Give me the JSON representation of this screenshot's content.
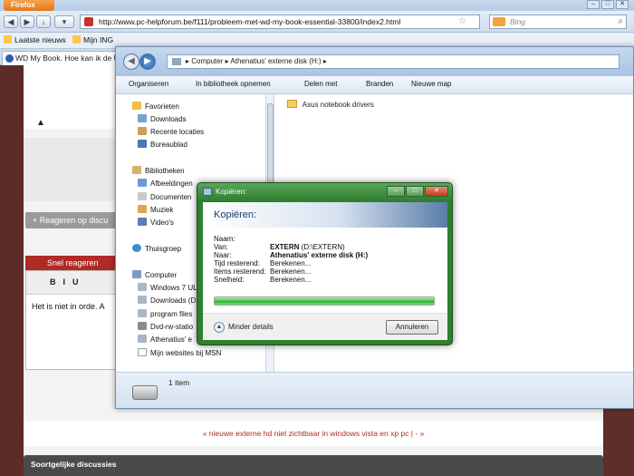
{
  "browser": {
    "menu_label": "Firefox",
    "url": "http://www.pc-helpforum.be/f111/probleem-met-wd-my-book-essential-33800/index2.html",
    "search_placeholder": "Bing",
    "bookmarks": [
      "Laatste nieuws",
      "Mijn ING"
    ],
    "tab_title": "WD My Book. Hoe kan ik de UI"
  },
  "forum": {
    "reply_button": "+ Reageren op discu",
    "quick_reply_title": "Snel reageren",
    "editor_text": "Het is niet in orde. A",
    "thread_nav": "« nieuwe externe hd niet zichtbaar in windows vista en xp pc | - »",
    "similar_title": "Soortgelijke discussies"
  },
  "explorer": {
    "path": [
      "Computer",
      "Athenatius' externe disk (H:)"
    ],
    "toolbar": [
      "Organiseren",
      "In bibliotheek opnemen",
      "Delen met",
      "Branden",
      "Nieuwe map"
    ],
    "nav": {
      "favorites_header": "Favorieten",
      "favorites": [
        "Downloads",
        "Recente locaties",
        "Bureaublad"
      ],
      "libraries_header": "Bibliotheken",
      "libraries": [
        "Afbeeldingen",
        "Documenten",
        "Muziek",
        "Video's"
      ],
      "homegroup": "Thuisgroep",
      "computer_header": "Computer",
      "computer": [
        "Windows 7 UL",
        "Downloads (D",
        "program files",
        "Dvd-rw-statio",
        "Athenatius' e",
        "Mijn websites bij MSN"
      ]
    },
    "folders": [
      "Asus notebook drivers"
    ],
    "item_count": "1 item"
  },
  "copy_dialog": {
    "window_title": "Kopiëren:",
    "heading": "Kopiëren:",
    "fields": [
      {
        "label": "Naam:",
        "value": "",
        "extra": ""
      },
      {
        "label": "Van:",
        "value": "EXTERN",
        "extra": " (D:\\EXTERN)"
      },
      {
        "label": "Naar:",
        "value": "Athenatius' externe disk (H:)",
        "extra": ""
      },
      {
        "label": "Tijd resterend:",
        "value": "",
        "extra": "Berekenen..."
      },
      {
        "label": "Items resterend:",
        "value": "",
        "extra": "Berekenen..."
      },
      {
        "label": "Snelheid:",
        "value": "",
        "extra": "Berekenen..."
      }
    ],
    "progress_fraction": 1.0,
    "less_details": "Minder details",
    "cancel": "Annuleren"
  },
  "colors": {
    "forum_red": "#b02a26",
    "dialog_frame": "#2e7f2e",
    "progress_green": "#2fb52f"
  }
}
